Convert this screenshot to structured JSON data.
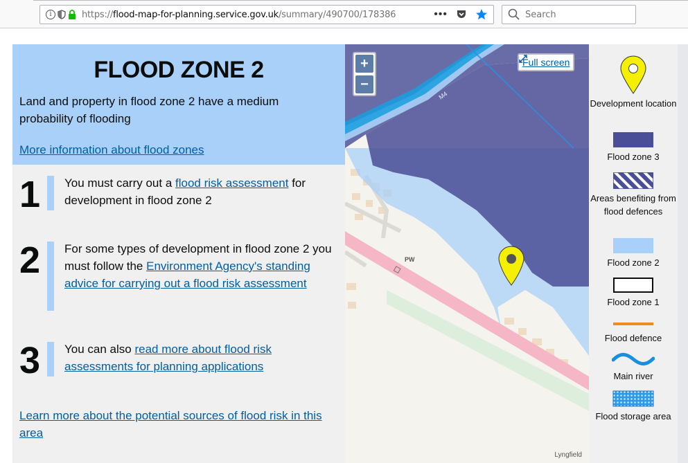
{
  "browser": {
    "url_prefix": "https://",
    "url_host": "flood-map-for-planning.service.gov.uk",
    "url_path": "/summary/490700/178386",
    "overflow_menu": "•••",
    "search_placeholder": "Search"
  },
  "summary": {
    "title": "FLOOD ZONE 2",
    "description": "Land and property in flood zone 2 have a medium probability of flooding",
    "more_info_link": "More information about flood zones"
  },
  "steps": [
    {
      "number": "1",
      "text_before": "You must carry out a ",
      "link": "flood risk assessment",
      "text_after": " for development in flood zone 2"
    },
    {
      "number": "2",
      "text_before": "For some types of development in flood zone 2 you must follow the ",
      "link": "Environment Agency's standing advice for carrying out a flood risk assessment",
      "text_after": ""
    },
    {
      "number": "3",
      "text_before": "You can also ",
      "link": "read more about flood risk assessments for planning applications",
      "text_after": ""
    }
  ],
  "learn_more_link": "Learn more about the potential sources of flood risk in this area",
  "map": {
    "zoom_in": "+",
    "zoom_out": "−",
    "fullscreen": "Full screen",
    "road_label": "M4",
    "place_label": "PW",
    "attribution": "Lyngfield"
  },
  "legend": [
    {
      "label": "Development location"
    },
    {
      "label": "Flood zone 3"
    },
    {
      "label": "Areas benefiting from flood defences"
    },
    {
      "label": "Flood zone 2"
    },
    {
      "label": "Flood zone 1"
    },
    {
      "label": "Flood defence"
    },
    {
      "label": "Main river"
    },
    {
      "label": "Flood storage area"
    }
  ],
  "colors": {
    "zone2": "#a8d0f8",
    "zone3": "#4a4e96",
    "link": "#005ea5",
    "defence": "#f18a1f",
    "river": "#1a8fe0",
    "marker": "#f5f000"
  }
}
